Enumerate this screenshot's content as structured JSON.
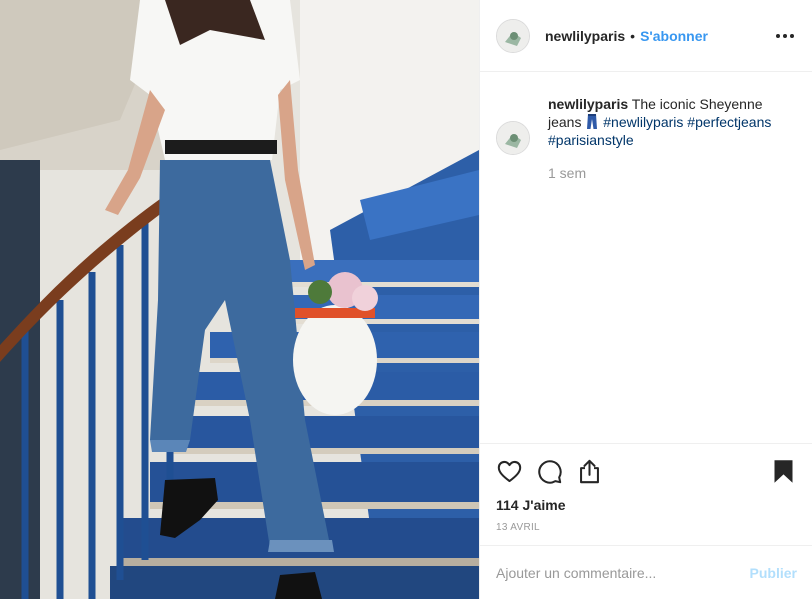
{
  "post": {
    "image_alt": "Woman in white t-shirt and flared blue jeans climbing a blue spiral staircase holding a white helmet with flowers"
  },
  "header": {
    "username": "newlilyparis",
    "separator": "•",
    "follow_label": "S'abonner",
    "more_icon": "more-options-icon"
  },
  "caption": {
    "username": "newlilyparis",
    "text_before": " The iconic Sheyenne jeans ",
    "emoji": "jeans",
    "hashtags": [
      "#newlilyparis",
      "#perfectjeans",
      "#parisianstyle"
    ],
    "time_ago": "1 sem"
  },
  "actions": {
    "icons": [
      "heart-icon",
      "comment-icon",
      "share-icon",
      "bookmark-icon"
    ],
    "likes": "114 J'aime",
    "date": "13 AVRIL"
  },
  "comment_box": {
    "placeholder": "Ajouter un commentaire...",
    "publish_label": "Publier"
  },
  "colors": {
    "accent": "#3897f0",
    "hashtag": "#003569",
    "muted": "#999999",
    "publish_disabled": "#b2dffc",
    "border": "#efefef"
  }
}
